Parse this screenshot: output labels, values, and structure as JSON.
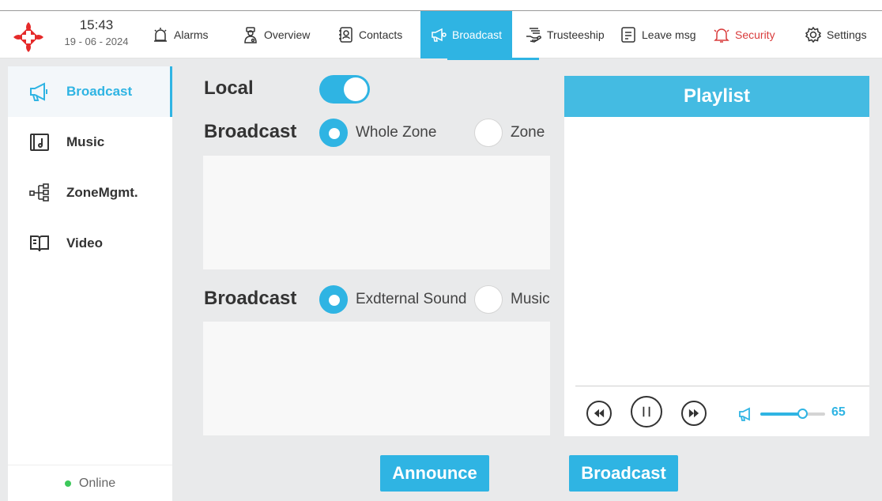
{
  "header": {
    "time": "15:43",
    "date": "19 - 06 - 2024",
    "nav": [
      {
        "label": "Alarms",
        "icon": "alarm-icon"
      },
      {
        "label": "Overview",
        "icon": "doctor-icon"
      },
      {
        "label": "Contacts",
        "icon": "contacts-icon"
      },
      {
        "label": "Broadcast",
        "icon": "megaphone-icon",
        "active": true
      },
      {
        "label": "Trusteeship",
        "icon": "hand-icon"
      },
      {
        "label": "Leave msg",
        "icon": "message-icon"
      },
      {
        "label": "Security",
        "icon": "bell-icon"
      },
      {
        "label": "Settings",
        "icon": "gear-icon"
      }
    ]
  },
  "sidebar": {
    "items": [
      {
        "label": "Broadcast",
        "icon": "megaphone-icon",
        "active": true
      },
      {
        "label": "Music",
        "icon": "music-icon"
      },
      {
        "label": "ZoneMgmt.",
        "icon": "zone-tree-icon"
      },
      {
        "label": "Video",
        "icon": "book-icon"
      }
    ],
    "status": "Online"
  },
  "main": {
    "local_label": "Local",
    "local_enabled": true,
    "broadcast_scope": {
      "label": "Broadcast",
      "options": [
        "Whole Zone",
        "Zone"
      ],
      "selected": "Whole Zone"
    },
    "broadcast_source": {
      "label": "Broadcast",
      "options": [
        "Exdternal Sound",
        "Music"
      ],
      "selected": "Exdternal Sound"
    },
    "announce_label": "Announce",
    "broadcast_button_label": "Broadcast"
  },
  "playlist": {
    "title": "Playlist",
    "volume": "65",
    "volume_fraction": 0.65
  },
  "colors": {
    "accent": "#2fb4e3",
    "danger": "#d93b3b",
    "online": "#3cc85a"
  }
}
